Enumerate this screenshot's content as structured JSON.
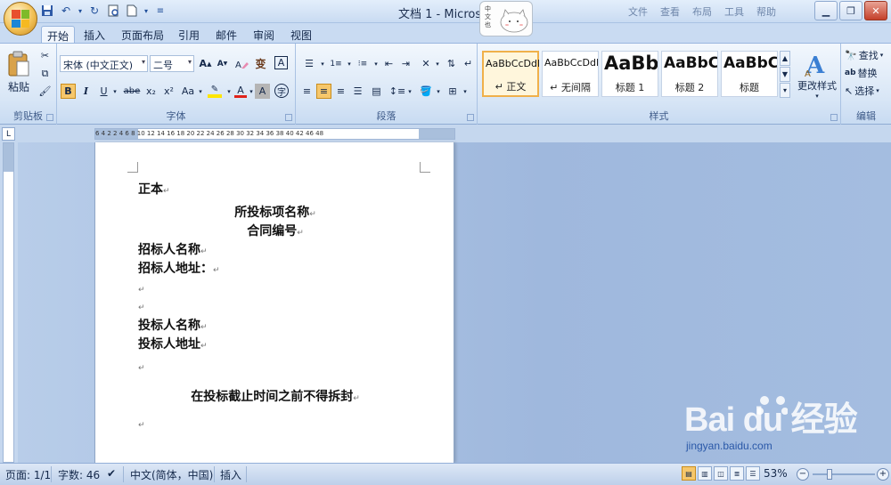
{
  "title_bar": {
    "doc_title": "文档 1 - Microso",
    "ghost_tabs": [
      "文件",
      "查看",
      "布局",
      "工具",
      "帮助"
    ]
  },
  "qat": {
    "icons": [
      "save-icon",
      "undo-icon",
      "redo-icon",
      "print-preview-icon",
      "new-document-icon",
      "customize-icon"
    ]
  },
  "sticker": {
    "text": "中文也"
  },
  "tabs": [
    "开始",
    "插入",
    "页面布局",
    "引用",
    "邮件",
    "审阅",
    "视图"
  ],
  "clipboard": {
    "paste_label": "粘贴",
    "group_label": "剪贴板"
  },
  "font": {
    "font_name": "宋体 (中文正文)",
    "font_size": "二号",
    "group_label": "字体",
    "grow": "A",
    "shrink": "A",
    "bold": "B",
    "italic": "I",
    "underline": "U",
    "strike": "abe",
    "sub": "x₂",
    "sup": "x²",
    "case": "Aa",
    "font_color": "A",
    "char_shade": "A",
    "enclose": "字",
    "phonetic": "变",
    "border_char": "A",
    "highlight_color": "#ffe600",
    "font_color_bar": "#e0231b"
  },
  "paragraph": {
    "group_label": "段落"
  },
  "styles": {
    "group_label": "样式",
    "change_styles": "更改样式",
    "items": [
      {
        "sample": "AaBbCcDdI",
        "name": "↵ 正文",
        "selected": true
      },
      {
        "sample": "AaBbCcDdI",
        "name": "↵ 无间隔",
        "selected": false
      },
      {
        "sample": "AaBb",
        "name": "标题 1",
        "selected": false
      },
      {
        "sample": "AaBbC",
        "name": "标题 2",
        "selected": false
      },
      {
        "sample": "AaBbC",
        "name": "标题",
        "selected": false
      }
    ]
  },
  "editing": {
    "group_label": "编辑",
    "find": "查找",
    "replace": "替换",
    "select": "选择"
  },
  "ruler": {
    "ticks": "6  4  2     2  4  6  8  10  12  14  16  18  20  22  24  26  28  30  32  34  36  38  40  42     46  48"
  },
  "document": {
    "lines": [
      "正本",
      "所投标项名称",
      "合同编号",
      "招标人名称",
      "招标人地址：",
      "投标人名称",
      "投标人地址",
      "在投标截止时间之前不得拆封"
    ],
    "paragraph_mark": "↵"
  },
  "watermark": {
    "logo": "Bai du 经验",
    "url": "jingyan.baidu.com"
  },
  "statusbar": {
    "page": "页面: 1/1",
    "words": "字数: 46",
    "language": "中文(简体，中国)",
    "mode": "插入",
    "zoom": "53%",
    "zoom_fraction": 0.53
  }
}
